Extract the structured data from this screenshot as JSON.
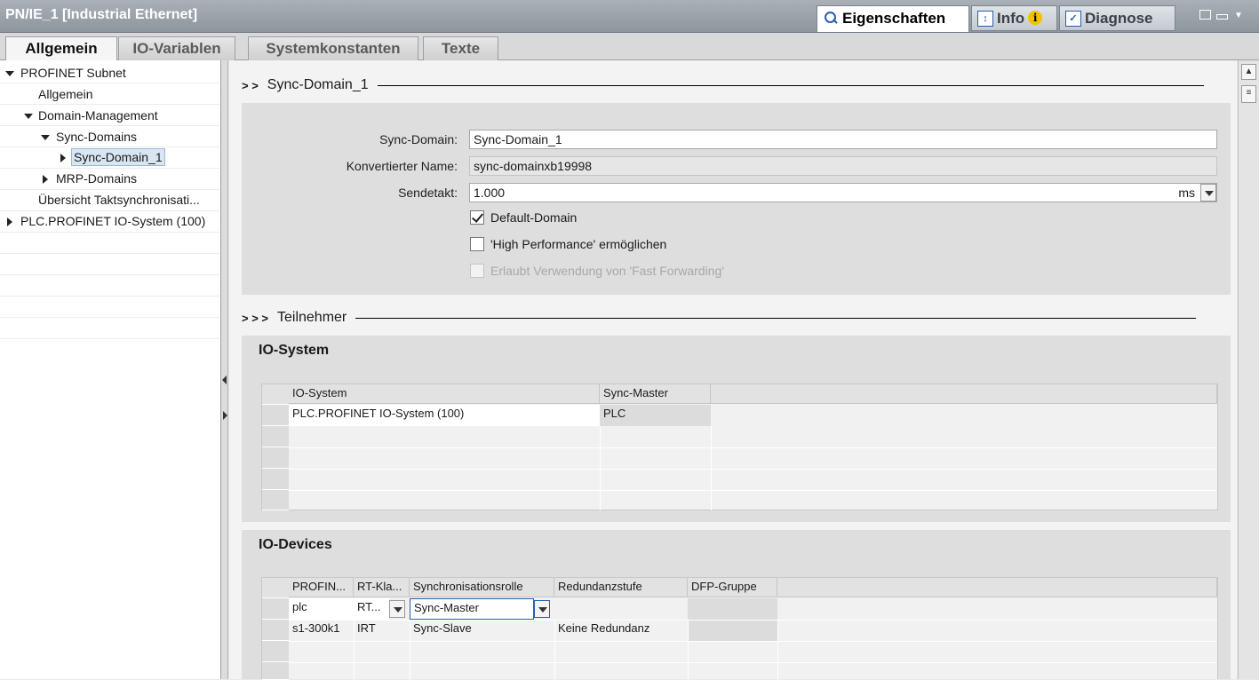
{
  "window": {
    "title": "PN/IE_1 [Industrial Ethernet]",
    "tabs": [
      {
        "label": "Eigenschaften",
        "icon": "properties-search-icon",
        "active": true
      },
      {
        "label": "Info",
        "icon": "info-icon",
        "badge": "i"
      },
      {
        "label": "Diagnose",
        "icon": "diagnose-icon"
      }
    ]
  },
  "subtabs": [
    "Allgemein",
    "IO-Variablen",
    "Systemkonstanten",
    "Texte"
  ],
  "tree": [
    {
      "label": "PROFINET Subnet",
      "expander": "expanded"
    },
    {
      "label": "Allgemein",
      "expander": "none"
    },
    {
      "label": "Domain-Management",
      "expander": "expanded"
    },
    {
      "label": "Sync-Domains",
      "expander": "expanded"
    },
    {
      "label": "Sync-Domain_1",
      "expander": "collapsed",
      "selected": true
    },
    {
      "label": "MRP-Domains",
      "expander": "collapsed"
    },
    {
      "label": "Übersicht Taktsynchronisati...",
      "expander": "none"
    },
    {
      "label": "PLC.PROFINET IO-System (100)",
      "expander": "collapsed"
    }
  ],
  "sync_section": {
    "header": "Sync-Domain_1",
    "chevrons": "> >",
    "fields": {
      "sync_domain_label": "Sync-Domain:",
      "sync_domain_value": "Sync-Domain_1",
      "converted_label": "Konvertierter Name:",
      "converted_value": "sync-domainxb19998",
      "sendetakt_label": "Sendetakt:",
      "sendetakt_value": "1.000",
      "sendetakt_unit": "ms"
    },
    "checkboxes": [
      {
        "label": "Default-Domain",
        "checked": true,
        "disabled": false
      },
      {
        "label": "'High Performance' ermöglichen",
        "checked": false,
        "disabled": false
      },
      {
        "label": "Erlaubt Verwendung von 'Fast Forwarding'",
        "checked": false,
        "disabled": true
      }
    ]
  },
  "participants": {
    "header": "Teilnehmer",
    "chevrons": "> > >",
    "io_system": {
      "title": "IO-System",
      "columns": [
        "IO-System",
        "Sync-Master"
      ],
      "rows": [
        [
          "PLC.PROFINET IO-System (100)",
          "PLC"
        ]
      ]
    },
    "io_devices": {
      "title": "IO-Devices",
      "columns": [
        "PROFIN...",
        "RT-Kla...",
        "Synchronisationsrolle",
        "Redundanzstufe",
        "DFP-Gruppe"
      ],
      "rows": [
        [
          "plc",
          "RT...",
          "Sync-Master",
          "",
          ""
        ],
        [
          "s1-300k1",
          "IRT",
          "Sync-Slave",
          "Keine Redundanz",
          ""
        ]
      ]
    }
  }
}
